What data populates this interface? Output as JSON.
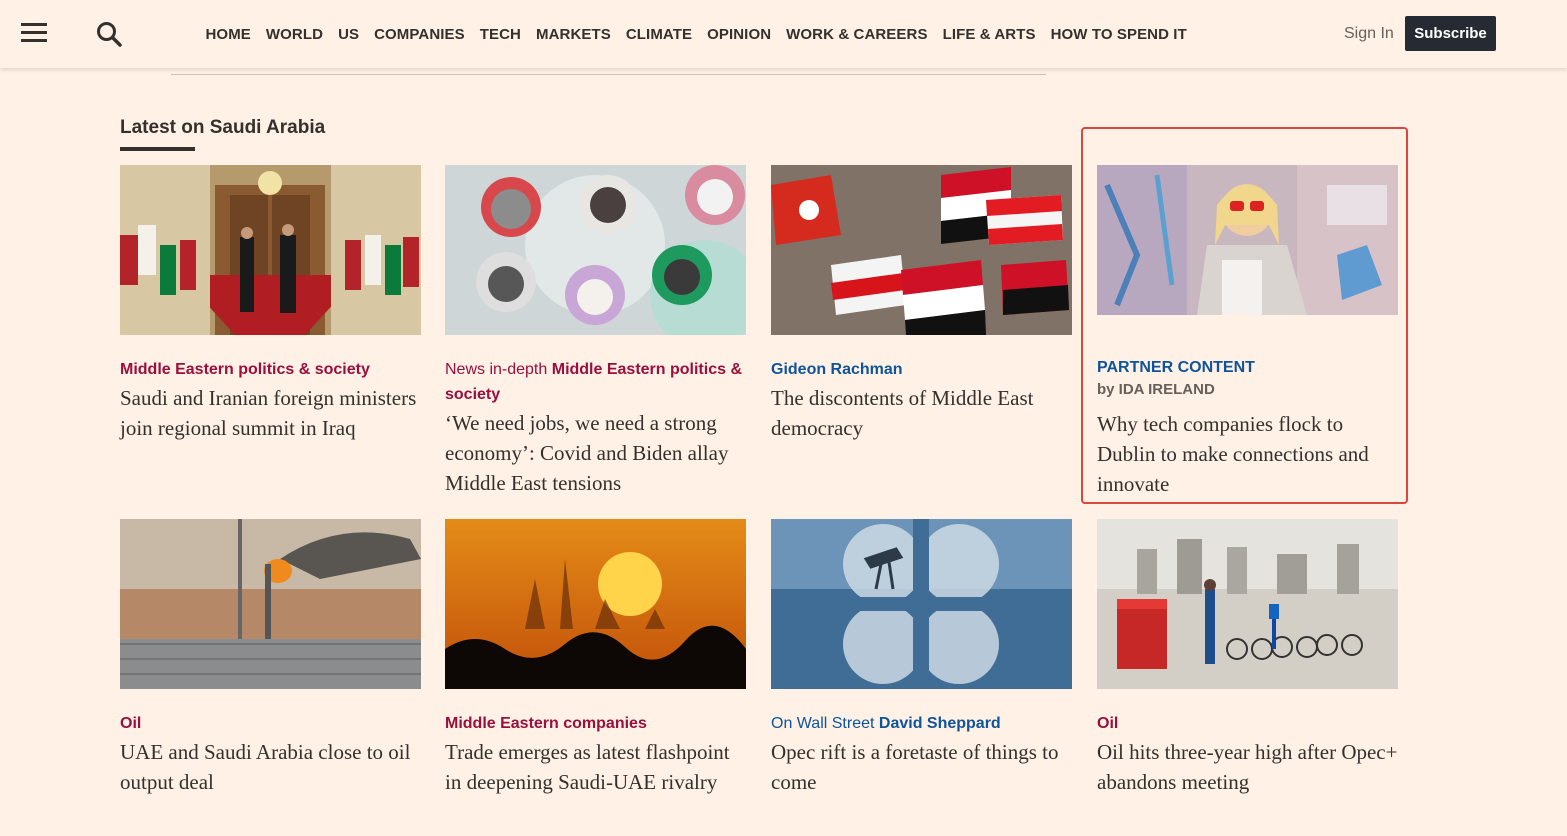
{
  "nav": {
    "items": [
      "HOME",
      "WORLD",
      "US",
      "COMPANIES",
      "TECH",
      "MARKETS",
      "CLIMATE",
      "OPINION",
      "WORK & CAREERS",
      "LIFE & ARTS",
      "HOW TO SPEND IT"
    ],
    "sign_in": "Sign In",
    "subscribe": "Subscribe"
  },
  "section": {
    "title": "Latest on Saudi Arabia"
  },
  "cards": [
    {
      "prefix": "",
      "tag": "Middle Eastern politics & society",
      "headline": "Saudi and Iranian foreign ministers join regional summit in Iraq",
      "image": "summit-photo"
    },
    {
      "prefix": "News in-depth",
      "tag": "Middle Eastern politics & society",
      "headline": "‘We need jobs, we need a strong economy’: Covid and Biden allay Middle East tensions",
      "image": "leaders-collage"
    },
    {
      "prefix": "",
      "tag": "Gideon Rachman",
      "headline": "The discontents of Middle East democracy",
      "image": "flags-crowd"
    },
    {
      "label": "PARTNER CONTENT",
      "by": "by IDA IRELAND",
      "headline": "Why tech companies flock to Dublin to make connections and innovate",
      "image": "woman-graffiti"
    },
    {
      "prefix": "",
      "tag": "Oil",
      "headline": "UAE and Saudi Arabia close to oil output deal",
      "image": "gas-flare"
    },
    {
      "prefix": "",
      "tag": "Middle Eastern companies",
      "headline": "Trade emerges as latest flashpoint in deepening Saudi-UAE rivalry",
      "image": "sunset-skyline"
    },
    {
      "prefix": "On Wall Street",
      "tag": "David Sheppard",
      "headline": "Opec rift is a foretaste of things to come",
      "image": "opec-logo"
    },
    {
      "prefix": "",
      "tag": "Oil",
      "headline": "Oil hits three-year high after Opec+ abandons meeting",
      "image": "bikes-construction"
    }
  ],
  "colors": {
    "background": "#fff1e5",
    "claret": "#990f3d",
    "oxford_blue": "#0f5499",
    "subscribe_bg": "#262a33",
    "highlight": "#d9483b"
  }
}
